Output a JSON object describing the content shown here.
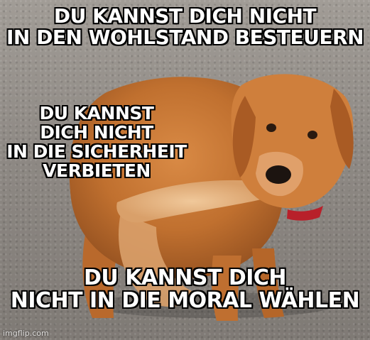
{
  "captions": {
    "top": "DU KANNST DICH NICHT\nIN DEN WOHLSTAND BESTEUERN",
    "middle": "DU KANNST\nDICH NICHT\nIN DIE SICHERHEIT\nVERBIETEN",
    "bottom": "DU KANNST DICH\nNICHT IN DIE MORAL WÄHLEN"
  },
  "watermark": "imgflip.com",
  "colors": {
    "text": "#ffffff",
    "outline": "#000000",
    "fur": "#c9793a",
    "gravel": "#8f8a85"
  }
}
